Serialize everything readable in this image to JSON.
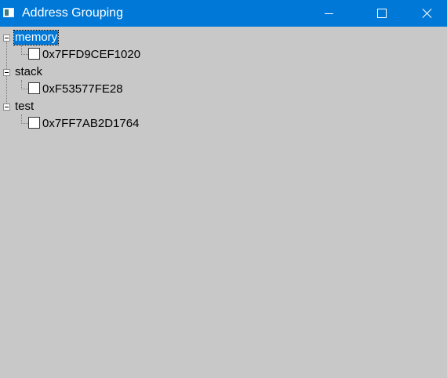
{
  "window": {
    "title": "Address Grouping",
    "app_icon": "window-icon",
    "controls": [
      "minimize-icon",
      "maximize-icon",
      "close-icon"
    ]
  },
  "tree": {
    "groups": [
      {
        "label": "memory",
        "selected": true,
        "expanded": true,
        "children": [
          {
            "label": "0x7FFD9CEF1020",
            "checked": false
          }
        ]
      },
      {
        "label": "stack",
        "selected": false,
        "expanded": true,
        "children": [
          {
            "label": "0xF53577FE28",
            "checked": false
          }
        ]
      },
      {
        "label": "test",
        "selected": false,
        "expanded": true,
        "children": [
          {
            "label": "0x7FF7AB2D1764",
            "checked": false
          }
        ]
      }
    ]
  },
  "colors": {
    "titlebar": "#0078d7",
    "background": "#c8c8c8",
    "selection": "#0078d7"
  }
}
